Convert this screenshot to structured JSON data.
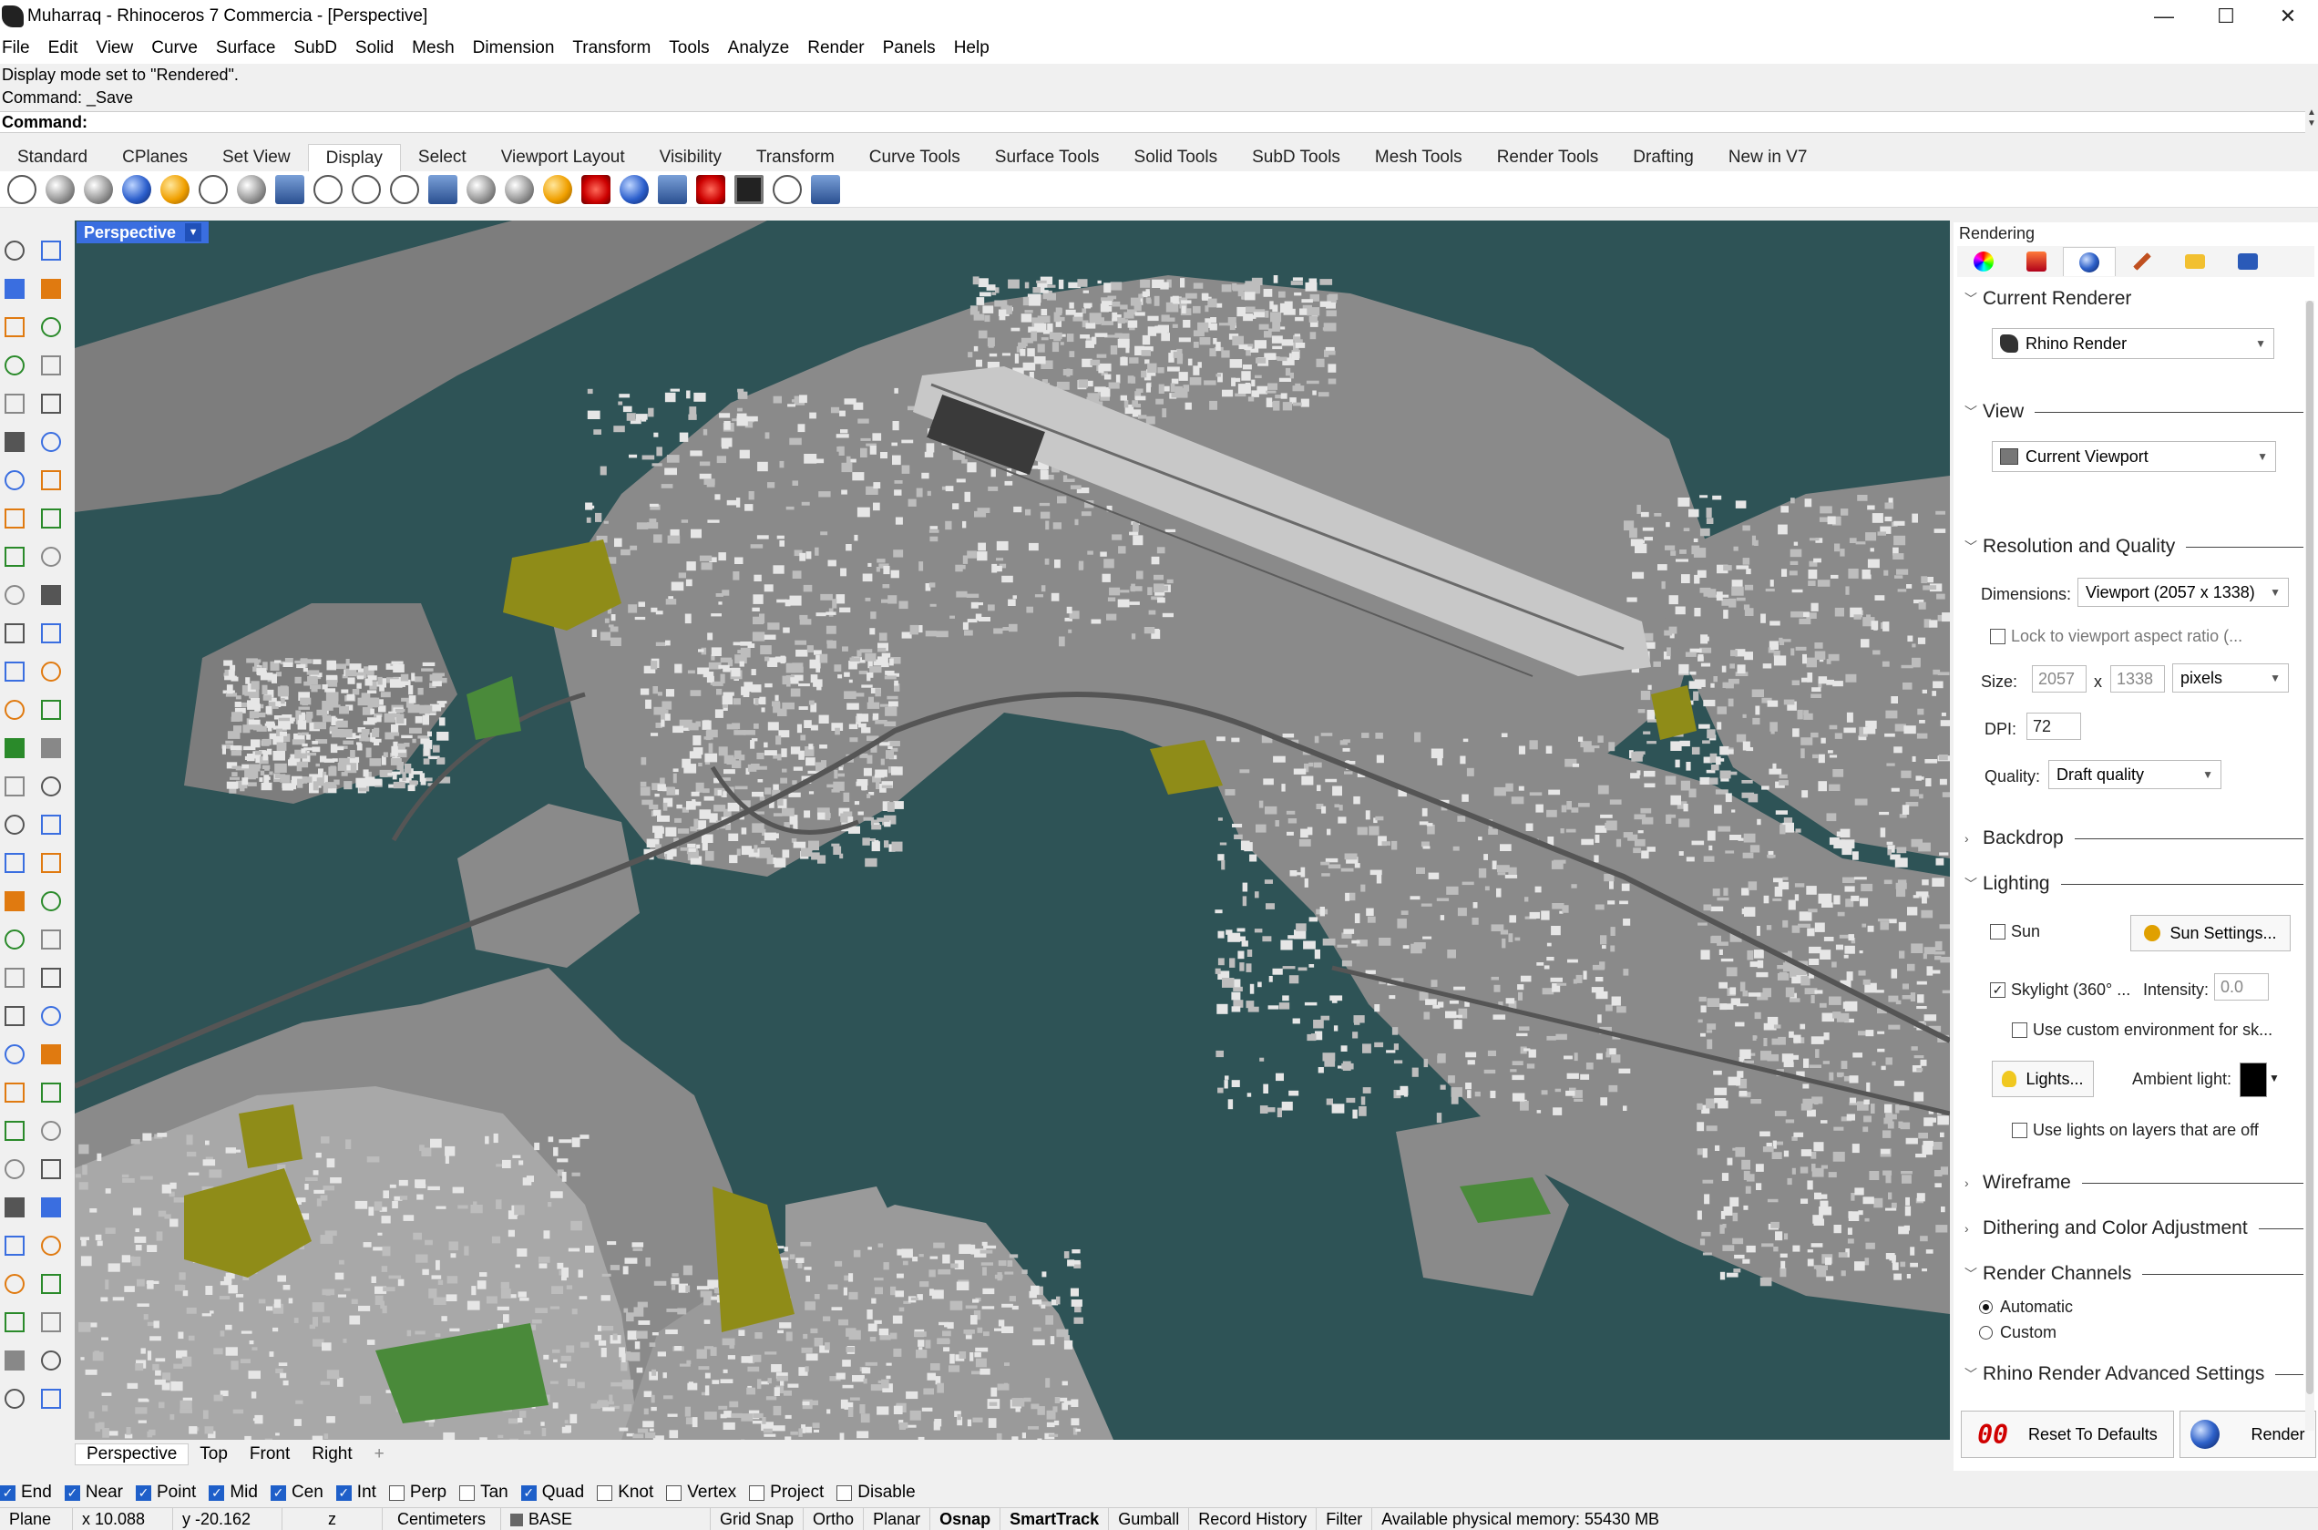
{
  "window": {
    "title": "Muharraq - Rhinoceros 7 Commercia - [Perspective]",
    "minimize_glyph": "—",
    "maximize_glyph": "☐",
    "close_glyph": "✕"
  },
  "menu": [
    "File",
    "Edit",
    "View",
    "Curve",
    "Surface",
    "SubD",
    "Solid",
    "Mesh",
    "Dimension",
    "Transform",
    "Tools",
    "Analyze",
    "Render",
    "Panels",
    "Help"
  ],
  "command": {
    "history": [
      "Display mode set to \"Rendered\".",
      "Command: _Save"
    ],
    "prompt": "Command:"
  },
  "toolbar_tabs": {
    "items": [
      "Standard",
      "CPlanes",
      "Set View",
      "Display",
      "Select",
      "Viewport Layout",
      "Visibility",
      "Transform",
      "Curve Tools",
      "Surface Tools",
      "Solid Tools",
      "SubD Tools",
      "Mesh Tools",
      "Render Tools",
      "Drafting",
      "New in V7"
    ],
    "active": "Display"
  },
  "toolbar_icons": [
    "wireframe-icon",
    "shaded-icon",
    "rendered-icon",
    "rendered-blue-icon",
    "gold-sphere-icon",
    "ghosted-icon",
    "xray-icon",
    "technical-icon",
    "artistic-icon",
    "pen-icon",
    "arctic-icon",
    "raytraced-icon",
    "display-options-icon",
    "zebra-icon",
    "sphere-icon",
    "light-bulb-icon",
    "cplane-icon",
    "capture-icon",
    "environment-icon",
    "disable-icon",
    "monitor-icon",
    "cube-icon",
    "tools-icon"
  ],
  "viewport": {
    "label": "Perspective",
    "tabs": [
      "Perspective",
      "Top",
      "Front",
      "Right"
    ],
    "add_tab_glyph": "+",
    "background": "#2e5356",
    "land": "#8a8a8a",
    "buildings": "#d4d4d4",
    "vegetation": "#8f8c18",
    "parks": "#4a8a3a"
  },
  "osnap": [
    {
      "label": "End",
      "checked": true
    },
    {
      "label": "Near",
      "checked": true
    },
    {
      "label": "Point",
      "checked": true
    },
    {
      "label": "Mid",
      "checked": true
    },
    {
      "label": "Cen",
      "checked": true
    },
    {
      "label": "Int",
      "checked": true
    },
    {
      "label": "Perp",
      "checked": false
    },
    {
      "label": "Tan",
      "checked": false
    },
    {
      "label": "Quad",
      "checked": true
    },
    {
      "label": "Knot",
      "checked": false
    },
    {
      "label": "Vertex",
      "checked": false
    },
    {
      "label": "Project",
      "checked": false
    },
    {
      "label": "Disable",
      "checked": false
    }
  ],
  "status": {
    "cplane": "Plane",
    "x": "x 10.088",
    "y": "y -20.162",
    "z": "z",
    "units": "Centimeters",
    "layer": "BASE",
    "toggles": [
      "Grid Snap",
      "Ortho",
      "Planar",
      "Osnap",
      "SmartTrack",
      "Gumball",
      "Record History",
      "Filter"
    ],
    "bold_toggles": [
      "Osnap",
      "SmartTrack"
    ],
    "memory": "Available physical memory: 55430 MB"
  },
  "panel": {
    "title": "Rendering",
    "tab_icons": [
      "color-wheel-icon",
      "material-icon",
      "render-settings-icon",
      "paint-brush-icon",
      "folder-icon",
      "view-capture-icon"
    ],
    "current_renderer": {
      "header": "Current Renderer",
      "value": "Rhino Render"
    },
    "view": {
      "header": "View",
      "value": "Current Viewport"
    },
    "resolution": {
      "header": "Resolution and Quality",
      "dimensions_label": "Dimensions:",
      "dimensions_value": "Viewport (2057 x 1338)",
      "lock_label": "Lock to viewport aspect ratio (...",
      "size_label": "Size:",
      "width": "2057",
      "x_sep": "x",
      "height": "1338",
      "units": "pixels",
      "dpi_label": "DPI:",
      "dpi": "72",
      "quality_label": "Quality:",
      "quality": "Draft quality"
    },
    "backdrop": {
      "header": "Backdrop"
    },
    "lighting": {
      "header": "Lighting",
      "sun_label": "Sun",
      "sun_checked": false,
      "sun_settings": "Sun Settings...",
      "skylight_label": "Skylight (360° ...",
      "skylight_checked": true,
      "intensity_label": "Intensity:",
      "intensity": "0.0",
      "custom_env_label": "Use custom environment for sk...",
      "lights_button": "Lights...",
      "ambient_label": "Ambient light:",
      "ambient_color": "#000000",
      "lights_off_label": "Use lights on layers that are off"
    },
    "wireframe": {
      "header": "Wireframe"
    },
    "dithering": {
      "header": "Dithering and Color Adjustment"
    },
    "channels": {
      "header": "Render Channels",
      "automatic": "Automatic",
      "custom": "Custom",
      "selected": "Automatic"
    },
    "advanced": {
      "header": "Rhino Render Advanced Settings"
    },
    "reset_label": "Reset To Defaults",
    "render_label": "Render"
  }
}
